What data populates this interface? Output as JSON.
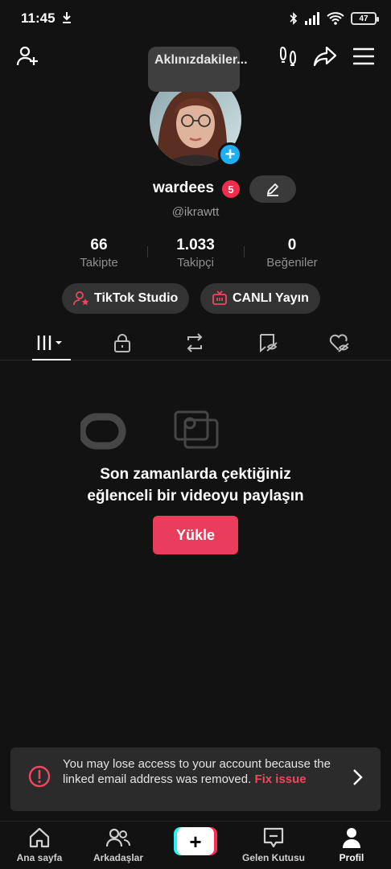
{
  "status_bar": {
    "time": "11:45",
    "battery": "47"
  },
  "tooltip": {
    "text": "Aklınızdakiler..."
  },
  "profile": {
    "username": "wardees",
    "badge_count": "5",
    "handle": "@ikrawtt"
  },
  "stats": [
    {
      "value": "66",
      "label": "Takipte"
    },
    {
      "value": "1.033",
      "label": "Takipçi"
    },
    {
      "value": "0",
      "label": "Beğeniler"
    }
  ],
  "actions": {
    "studio_label": "TikTok Studio",
    "live_label": "CANLI Yayın"
  },
  "empty_state": {
    "line1": "Son zamanlarda çektiğiniz",
    "line2": "eğlenceli bir videoyu paylaşın",
    "upload_label": "Yükle"
  },
  "alert": {
    "message": "You may lose access to your account because the linked email address was removed.",
    "action": "Fix issue"
  },
  "navbar": {
    "home": "Ana sayfa",
    "friends": "Arkadaşlar",
    "inbox": "Gelen Kutusu",
    "profile": "Profil"
  },
  "colors": {
    "accent": "#ea3d5c",
    "badge": "#f22c4c",
    "plus": "#20aef2"
  }
}
